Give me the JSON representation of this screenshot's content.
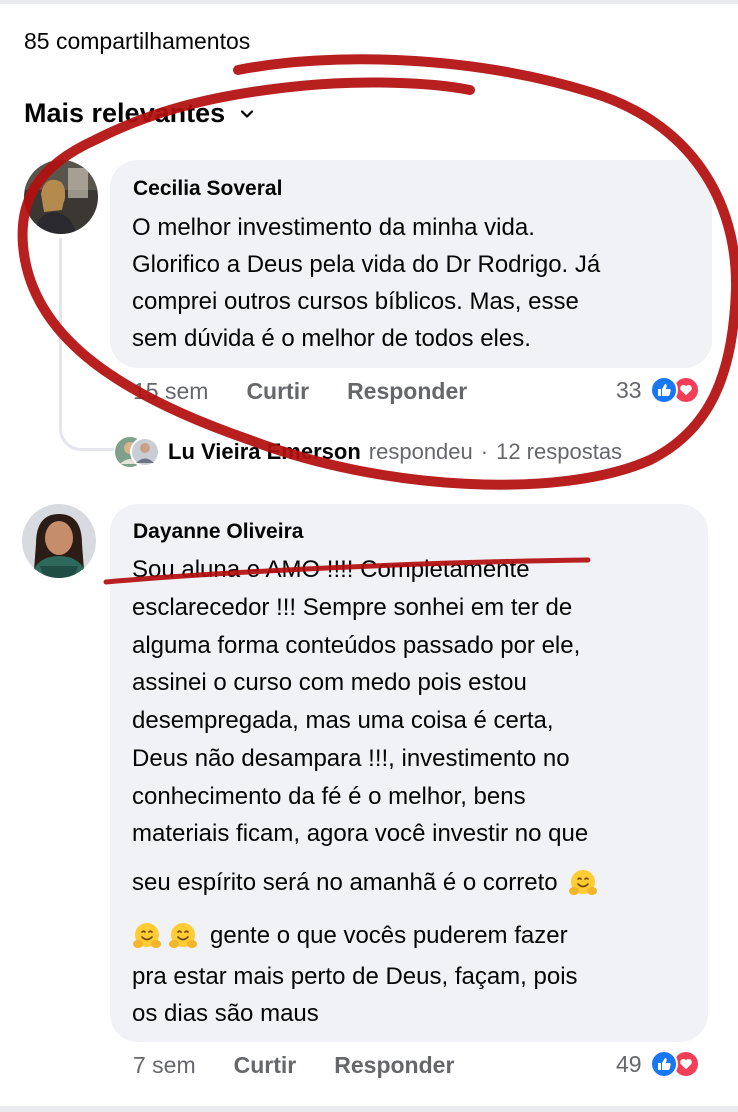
{
  "header": {
    "shares_label": "85 compartilhamentos",
    "sort_label": "Mais relevantes"
  },
  "comments": [
    {
      "author": "Cecilia Soveral",
      "lines": [
        "O melhor investimento da minha vida.",
        "Glorifico a Deus pela vida do Dr Rodrigo. Já",
        "comprei outros cursos bíblicos. Mas, esse",
        "sem dúvida é o melhor de todos eles."
      ],
      "time": "15 sem",
      "like_label": "Curtir",
      "reply_label": "Responder",
      "reaction_count": "33",
      "replies": {
        "author": "Lu Vieira Emerson",
        "verb": "respondeu",
        "separator": "·",
        "count_label": "12 respostas"
      }
    },
    {
      "author": "Dayanne Oliveira",
      "lines": [
        "Sou aluna e AMO !!!! Completamente",
        "esclarecedor !!!  Sempre sonhei em ter de",
        "alguma forma conteúdos passado por ele,",
        "assinei o curso com medo pois estou",
        "desempregada, mas uma coisa é certa,",
        "Deus não desampara !!!, investimento no",
        "conhecimento da fé é o melhor, bens",
        "materiais ficam, agora você investir no que",
        "seu espírito será no amanhã é o correto",
        "gente o que vocês puderem fazer",
        "pra estar mais perto de Deus, façam, pois",
        "os dias são maus"
      ],
      "time": "7 sem",
      "like_label": "Curtir",
      "reply_label": "Responder",
      "reaction_count": "49"
    }
  ],
  "icons": {
    "sort": "chevron-down-icon",
    "like_reaction": "like-reaction-icon",
    "love_reaction": "love-reaction-icon",
    "emoji": "hugging-face-emoji"
  },
  "colors": {
    "bubble": "#f0f2f5",
    "meta_text": "#65676b",
    "like_blue": "#1877f2",
    "love_red": "#f33e58",
    "annotation_red": "#b30f0f"
  }
}
